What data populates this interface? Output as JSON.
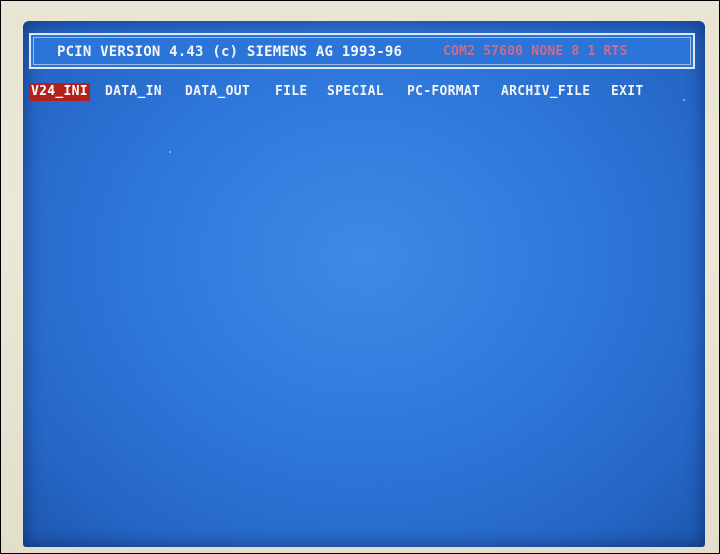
{
  "title_bar": {
    "program": "PCIN VERSION 4.43 (c) SIEMENS AG 1993-96",
    "status": "COM2 57600 NONE 8 1 RTS"
  },
  "menu": {
    "items": [
      {
        "label": "V24_INI",
        "selected": true
      },
      {
        "label": "DATA_IN",
        "selected": false
      },
      {
        "label": "DATA_OUT",
        "selected": false
      },
      {
        "label": "FILE",
        "selected": false
      },
      {
        "label": "SPECIAL",
        "selected": false
      },
      {
        "label": "PC-FORMAT",
        "selected": false
      },
      {
        "label": "ARCHIV_FILE",
        "selected": false
      },
      {
        "label": "EXIT",
        "selected": false
      }
    ]
  },
  "colors": {
    "screen_background": "#2f78db",
    "menu_highlight": "#b3211d",
    "status_text": "#d26a87",
    "text": "#f1f4fa"
  }
}
